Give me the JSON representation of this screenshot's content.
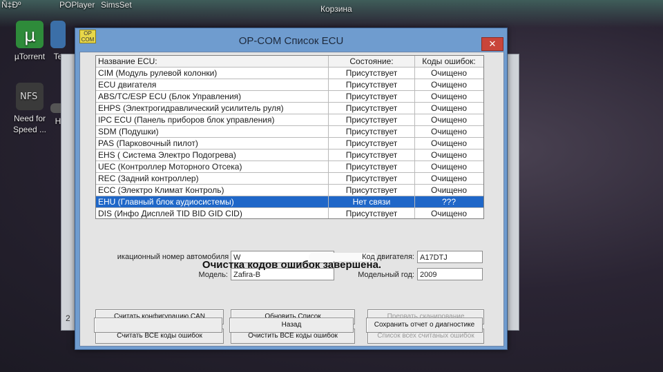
{
  "desktop": {
    "top_labels": [
      "Ñ‡Ðº",
      "POPlayer",
      "SimsSet"
    ],
    "recycle_bin_label": "Корзина",
    "icons": [
      {
        "label": "µTorrent",
        "icon": "utorrent-icon"
      },
      {
        "label": "Te",
        "icon": "app-icon"
      },
      {
        "label": "Need for Speed ...",
        "icon": "nfs-icon"
      },
      {
        "label": "H",
        "icon": "app-icon"
      }
    ]
  },
  "background_window": {
    "number": "2"
  },
  "dialog": {
    "title": "OP-COM Список ECU",
    "icon_text": "OP COM",
    "close_symbol": "✕"
  },
  "table": {
    "headers": {
      "name": "Название ECU:",
      "state": "Состояние:",
      "codes": "Коды ошибок:"
    },
    "rows": [
      {
        "name": "CIM (Модуль рулевой колонки)",
        "state": "Присутствует",
        "codes": "Очищено",
        "selected": false
      },
      {
        "name": "ECU двигателя",
        "state": "Присутствует",
        "codes": "Очищено",
        "selected": false
      },
      {
        "name": "ABS/TC/ESP ECU (Блок Управления)",
        "state": "Присутствует",
        "codes": "Очищено",
        "selected": false
      },
      {
        "name": "EHPS (Электрогидравлический усилитель руля)",
        "state": "Присутствует",
        "codes": "Очищено",
        "selected": false
      },
      {
        "name": "IPC ECU (Панель приборов блок управления)",
        "state": "Присутствует",
        "codes": "Очищено",
        "selected": false
      },
      {
        "name": "SDM (Подушки)",
        "state": "Присутствует",
        "codes": "Очищено",
        "selected": false
      },
      {
        "name": "PAS (Парковочный пилот)",
        "state": "Присутствует",
        "codes": "Очищено",
        "selected": false
      },
      {
        "name": "EHS ( Система Электро Подогрева)",
        "state": "Присутствует",
        "codes": "Очищено",
        "selected": false
      },
      {
        "name": "UEC (Контроллер Моторного Отсека)",
        "state": "Присутствует",
        "codes": "Очищено",
        "selected": false
      },
      {
        "name": "REC (Задний контроллер)",
        "state": "Присутствует",
        "codes": "Очищено",
        "selected": false
      },
      {
        "name": "ECC (Электро Климат Контроль)",
        "state": "Присутствует",
        "codes": "Очищено",
        "selected": false
      },
      {
        "name": "EHU (Главный блок аудиосистемы)",
        "state": "Нет связи",
        "codes": "???",
        "selected": true
      },
      {
        "name": "DIS (Инфо Дисплей TID  BID  GID CID)",
        "state": "Присутствует",
        "codes": "Очищено",
        "selected": false
      }
    ]
  },
  "vehicle": {
    "vin_label": "икационный номер автомобиля (VIN):",
    "vin_value": "W",
    "engine_code_label": "Код двигателя:",
    "engine_code_value": "A17DTJ",
    "model_label": "Модель:",
    "model_value": "Zafira-B",
    "model_year_label": "Модельный год:",
    "model_year_value": "2009"
  },
  "status_message": "Очистка кодов ошибок завершена.",
  "buttons": {
    "read_can": "Считать конфигурацию CAN",
    "refresh": "Обновить Список",
    "stop_scan": "Прервать сканирование",
    "read_all_codes": "Считать ВСЕ коды ошибок",
    "clear_all_codes": "Очистить ВСЕ коды ошибок",
    "read_codes_list": "Список всех считаных ошибок",
    "empty": "",
    "back": "Назад",
    "save_report": "Сохранить отчет о диагностике"
  },
  "colors": {
    "dialog_frame": "#6f9ccf",
    "selected_row": "#1f67c8",
    "close_button": "#c9453a"
  }
}
